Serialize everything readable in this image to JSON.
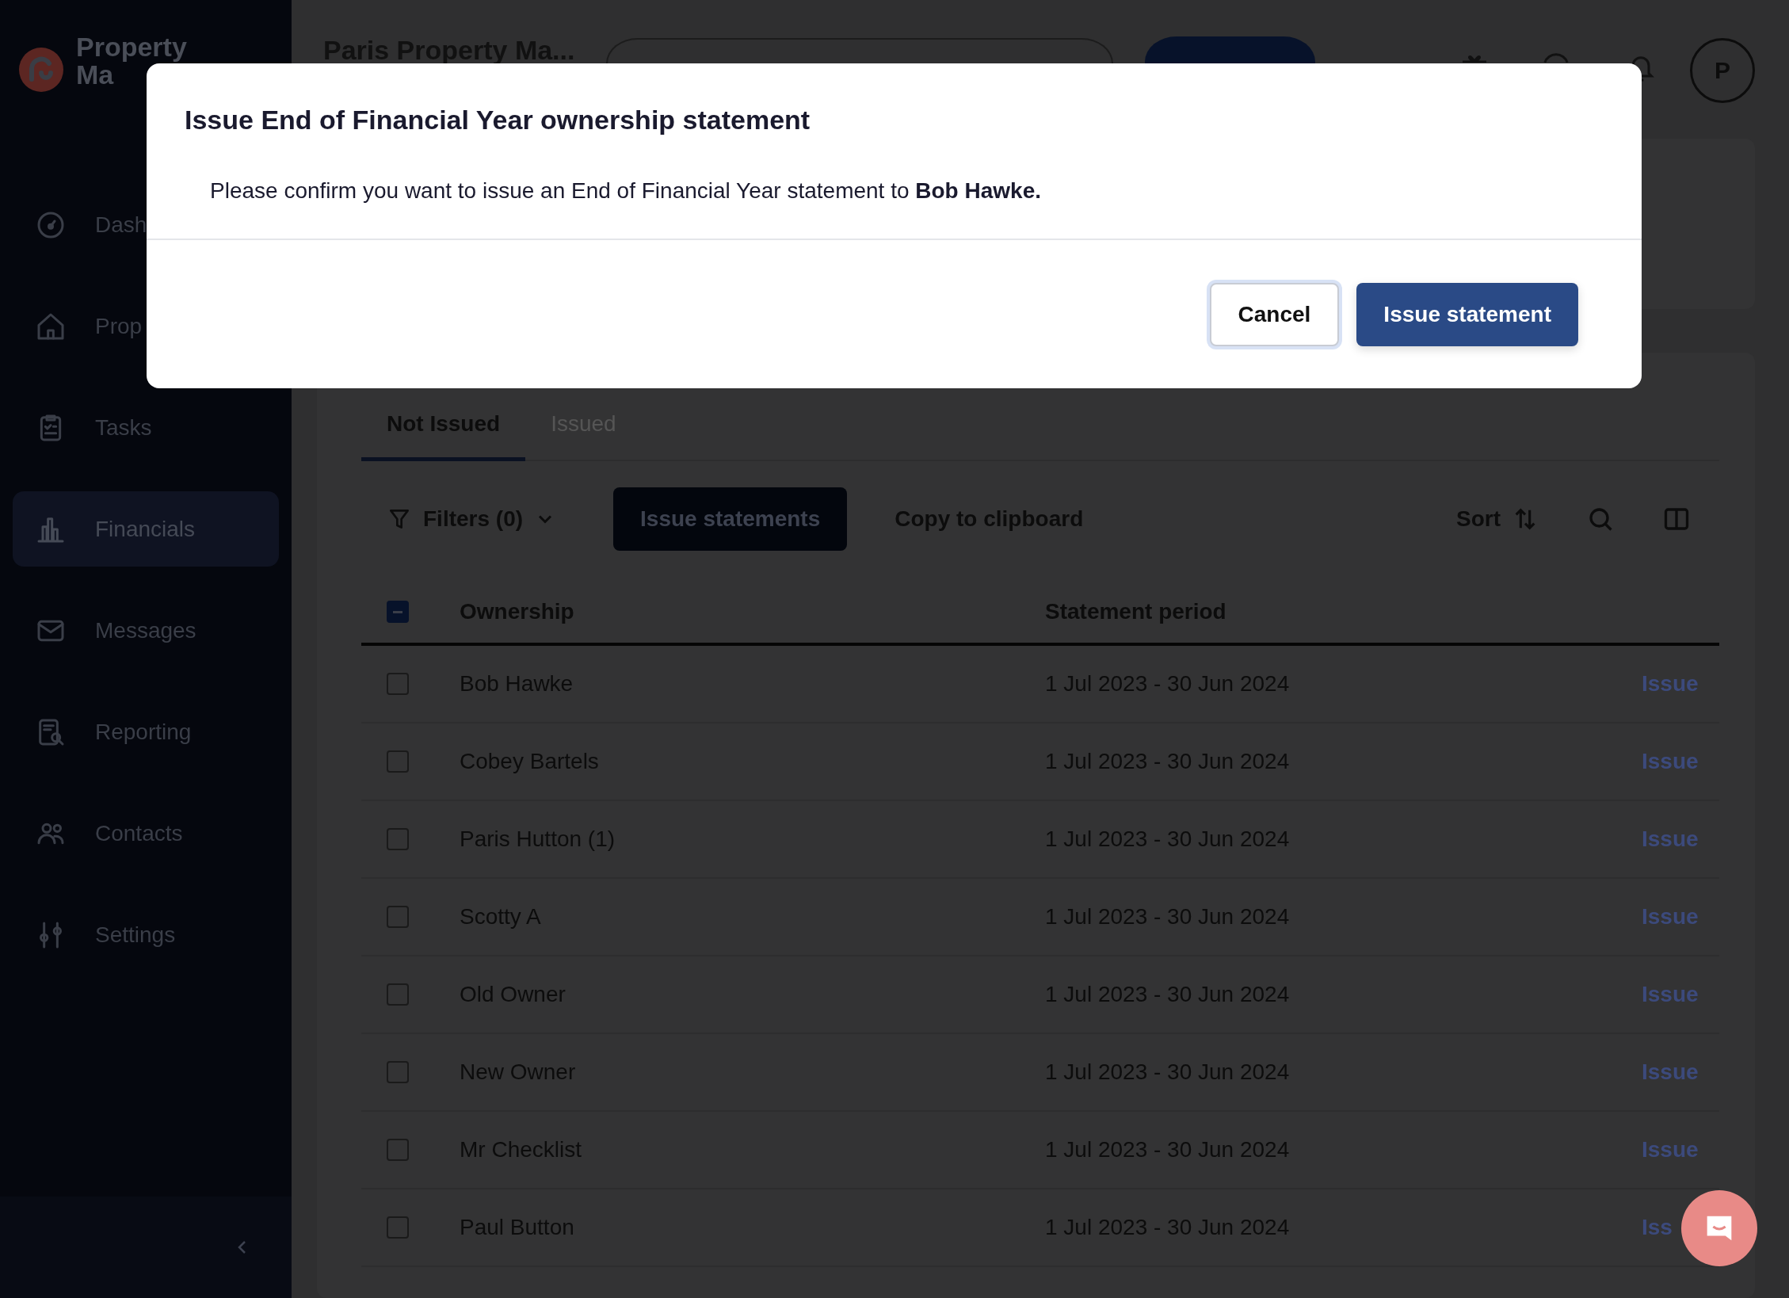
{
  "sidebar": {
    "logo_lines": [
      "Property",
      "Ma"
    ],
    "items": [
      {
        "label": "Dash",
        "selected": false
      },
      {
        "label": "Prop",
        "selected": false
      },
      {
        "label": "Tasks",
        "selected": false
      },
      {
        "label": "Financials",
        "selected": true
      },
      {
        "label": "Messages",
        "selected": false
      },
      {
        "label": "Reporting",
        "selected": false
      },
      {
        "label": "Contacts",
        "selected": false
      },
      {
        "label": "Settings",
        "selected": false
      }
    ]
  },
  "header": {
    "title": "Paris Property Ma...",
    "avatar": "P"
  },
  "tabs": [
    {
      "label": "Not Issued",
      "selected": true
    },
    {
      "label": "Issued",
      "selected": false
    }
  ],
  "toolbar": {
    "filters": "Filters (0)",
    "issue_button": "Issue statements",
    "copy_link": "Copy to clipboard",
    "sort": "Sort"
  },
  "table": {
    "select_all": {
      "indeterminate": true
    },
    "columns": [
      "Ownership",
      "Statement period"
    ],
    "rows": [
      {
        "ownership": "Bob Hawke",
        "period": "1 Jul 2023 - 30 Jun 2024",
        "action": "Issue",
        "checked": false
      },
      {
        "ownership": "Cobey Bartels",
        "period": "1 Jul 2023 - 30 Jun 2024",
        "action": "Issue",
        "checked": false
      },
      {
        "ownership": "Paris Hutton (1)",
        "period": "1 Jul 2023 - 30 Jun 2024",
        "action": "Issue",
        "checked": false
      },
      {
        "ownership": "Scotty A",
        "period": "1 Jul 2023 - 30 Jun 2024",
        "action": "Issue",
        "checked": false
      },
      {
        "ownership": "Old Owner",
        "period": "1 Jul 2023 - 30 Jun 2024",
        "action": "Issue",
        "checked": false
      },
      {
        "ownership": "New Owner",
        "period": "1 Jul 2023 - 30 Jun 2024",
        "action": "Issue",
        "checked": false
      },
      {
        "ownership": "Mr Checklist",
        "period": "1 Jul 2023 - 30 Jun 2024",
        "action": "Issue",
        "checked": false
      },
      {
        "ownership": "Paul Button",
        "period": "1 Jul 2023 - 30 Jun 2024",
        "action": "Iss",
        "checked": false
      }
    ]
  },
  "dialog": {
    "title": "Issue End of Financial Year ownership statement",
    "message": "Please confirm you want to issue an End of Financial Year statement to **Bob Hawke.**",
    "buttons": [
      {
        "label": "Cancel",
        "kind": "secondary"
      },
      {
        "label": "Issue statement",
        "kind": "primary"
      }
    ]
  }
}
